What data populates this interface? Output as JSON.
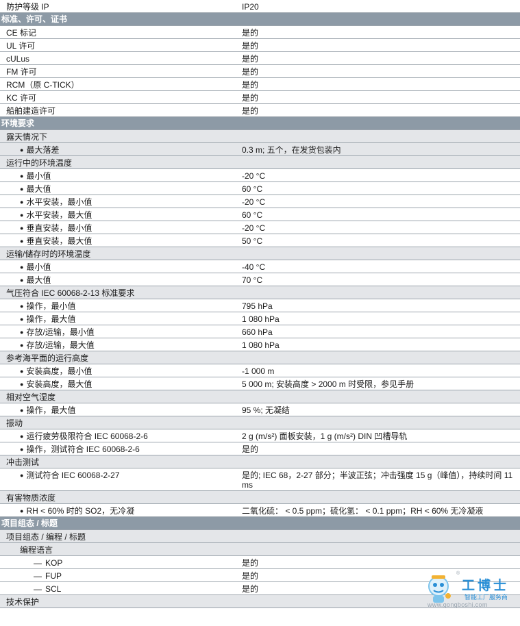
{
  "rows": {
    "r0": {
      "k": "防护等级 IP",
      "v": "IP20"
    },
    "s1": "标准、许可、证书",
    "r2": {
      "k": "CE 标记",
      "v": "是的"
    },
    "r3": {
      "k": "UL 许可",
      "v": "是的"
    },
    "r4": {
      "k": "cULus",
      "v": "是的"
    },
    "r5": {
      "k": "FM 许可",
      "v": "是的"
    },
    "r6": {
      "k": "RCM（原 C-TICK）",
      "v": "是的"
    },
    "r7": {
      "k": "KC 许可",
      "v": "是的"
    },
    "r8": {
      "k": "船舶建造许可",
      "v": "是的"
    },
    "s9": "环境要求",
    "h10": "露天情况下",
    "r11": {
      "k": "最大落差",
      "v": "0.3 m; 五个，在发货包装内"
    },
    "h12": "运行中的环境温度",
    "r13": {
      "k": "最小值",
      "v": "-20 °C"
    },
    "r14": {
      "k": "最大值",
      "v": "60 °C"
    },
    "r15": {
      "k": "水平安装，最小值",
      "v": "-20 °C"
    },
    "r16": {
      "k": "水平安装，最大值",
      "v": "60 °C"
    },
    "r17": {
      "k": "垂直安装，最小值",
      "v": "-20 °C"
    },
    "r18": {
      "k": "垂直安装，最大值",
      "v": "50 °C"
    },
    "h19": "运输/储存时的环境温度",
    "r20": {
      "k": "最小值",
      "v": "-40 °C"
    },
    "r21": {
      "k": "最大值",
      "v": "70 °C"
    },
    "h22": "气压符合 IEC 60068-2-13 标准要求",
    "r23": {
      "k": "操作，最小值",
      "v": "795 hPa"
    },
    "r24": {
      "k": "操作，最大值",
      "v": "1 080 hPa"
    },
    "r25": {
      "k": "存放/运输，最小值",
      "v": "660 hPa"
    },
    "r26": {
      "k": "存放/运输，最大值",
      "v": "1 080 hPa"
    },
    "h27": "参考海平面的运行高度",
    "r28": {
      "k": "安装高度，最小值",
      "v": "-1 000 m"
    },
    "r29": {
      "k": "安装高度，最大值",
      "v": "5 000 m; 安装高度 > 2000 m 时受限，参见手册"
    },
    "h30": "相对空气湿度",
    "r31": {
      "k": "操作，最大值",
      "v": "95 %; 无凝结"
    },
    "h32": "振动",
    "r33": {
      "k": "运行疲劳极限符合 IEC 60068-2-6",
      "v": "2 g (m/s²) 面板安装，1 g (m/s²) DIN 凹槽导轨"
    },
    "r34": {
      "k": "操作，测试符合 IEC 60068-2-6",
      "v": "是的"
    },
    "h35": "冲击测试",
    "r36": {
      "k": "测试符合 IEC 60068-2-27",
      "v": "是的; IEC 68，2-27 部分；半波正弦；冲击强度 15 g（峰值），持续时间 11 ms"
    },
    "h37": "有害物质浓度",
    "r38": {
      "k": "RH < 60% 时的 SO2，无冷凝",
      "v": "二氧化硫： < 0.5 ppm；硫化氢： < 0.1 ppm；RH < 60% 无冷凝液"
    },
    "s39": "项目组态 / 标题",
    "h40": "项目组态 / 编程 / 标题",
    "h41": "编程语言",
    "r42": {
      "k": "KOP",
      "v": "是的"
    },
    "r43": {
      "k": "FUP",
      "v": "是的"
    },
    "r44": {
      "k": "SCL",
      "v": "是的"
    },
    "h45": "技术保护"
  },
  "symbols": {
    "bullet": "●",
    "dash": "—"
  },
  "watermark": {
    "name": "工博士",
    "tagline": "智能工厂服务商",
    "url": "www.gongboshi.com",
    "reg": "®"
  },
  "icons": [
    "bullet-icon",
    "dash-icon",
    "robot-mascot-icon"
  ]
}
